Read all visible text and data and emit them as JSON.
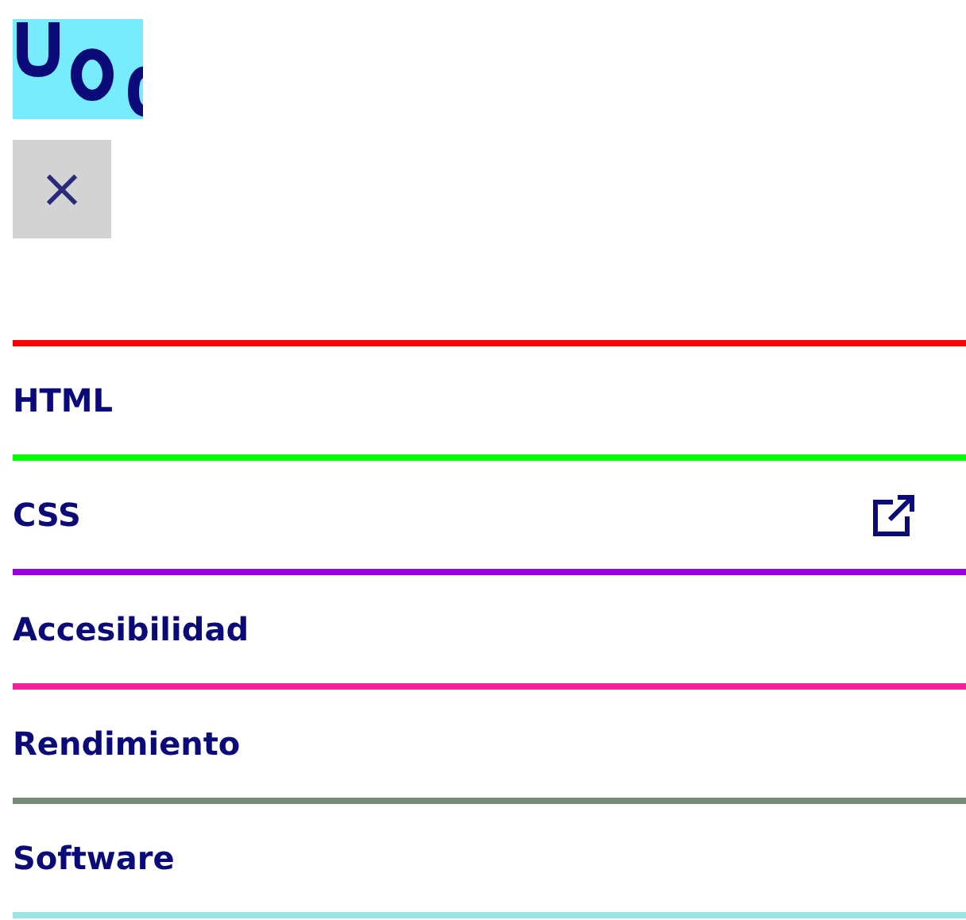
{
  "close_button": {
    "label": "×"
  },
  "menu": [
    {
      "label": "HTML",
      "color": "#ff0000",
      "external": false
    },
    {
      "label": "CSS",
      "color": "#00ff00",
      "external": true
    },
    {
      "label": "Accesibilidad",
      "color": "#9900dd",
      "external": false
    },
    {
      "label": "Rendimiento",
      "color": "#ee2299",
      "external": false
    },
    {
      "label": "Software",
      "color": "#778877",
      "external": false
    },
    {
      "color": "#99e6e6"
    }
  ]
}
